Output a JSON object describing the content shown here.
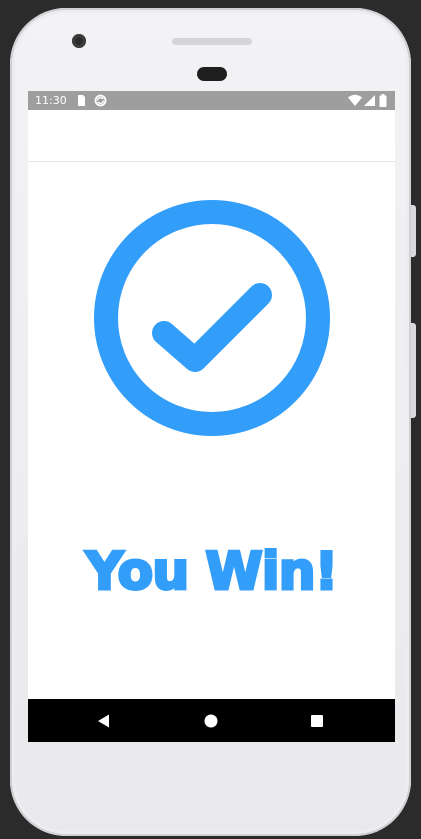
{
  "device": {
    "frame_color": "#efeff1"
  },
  "status_bar": {
    "time": "11:30",
    "background": "#9e9e9e",
    "left_icons": [
      "sim-card-icon",
      "sync-icon"
    ],
    "right_icons": [
      "wifi-icon",
      "signal-icon",
      "battery-icon"
    ]
  },
  "app": {
    "background": "#ffffff",
    "accent": "#339ef9",
    "result_icon": "check-circle-icon",
    "result_text": "You Win!"
  },
  "nav_bar": {
    "buttons": [
      "back-icon",
      "home-icon",
      "recents-icon"
    ]
  }
}
